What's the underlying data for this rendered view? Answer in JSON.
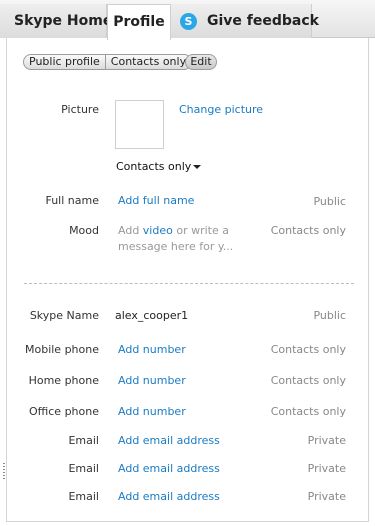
{
  "tabs": {
    "home": "Skype Home",
    "profile": "Profile",
    "feedback": "Give feedback"
  },
  "view_toggle": {
    "public": "Public profile",
    "contacts": "Contacts only",
    "edit": "Edit"
  },
  "picture": {
    "label": "Picture",
    "change": "Change picture",
    "privacy": "Contacts only"
  },
  "fields": {
    "full_name": {
      "label": "Full name",
      "action": "Add full name",
      "privacy": "Public"
    },
    "mood": {
      "label": "Mood",
      "prefix": "Add ",
      "link": "video",
      "rest": " or write a message here for y...",
      "privacy": "Contacts only"
    },
    "skype_name": {
      "label": "Skype Name",
      "value": "alex_cooper1",
      "privacy": "Public"
    },
    "mobile": {
      "label": "Mobile phone",
      "action": "Add number",
      "privacy": "Contacts only"
    },
    "home": {
      "label": "Home phone",
      "action": "Add number",
      "privacy": "Contacts only"
    },
    "office": {
      "label": "Office phone",
      "action": "Add number",
      "privacy": "Contacts only"
    },
    "email1": {
      "label": "Email",
      "action": "Add email address",
      "privacy": "Private"
    },
    "email2": {
      "label": "Email",
      "action": "Add email address",
      "privacy": "Private"
    },
    "email3": {
      "label": "Email",
      "action": "Add email address",
      "privacy": "Private"
    }
  },
  "icons": {
    "feedback": "skype-feedback-icon",
    "dropdown": "chevron-down-icon"
  }
}
